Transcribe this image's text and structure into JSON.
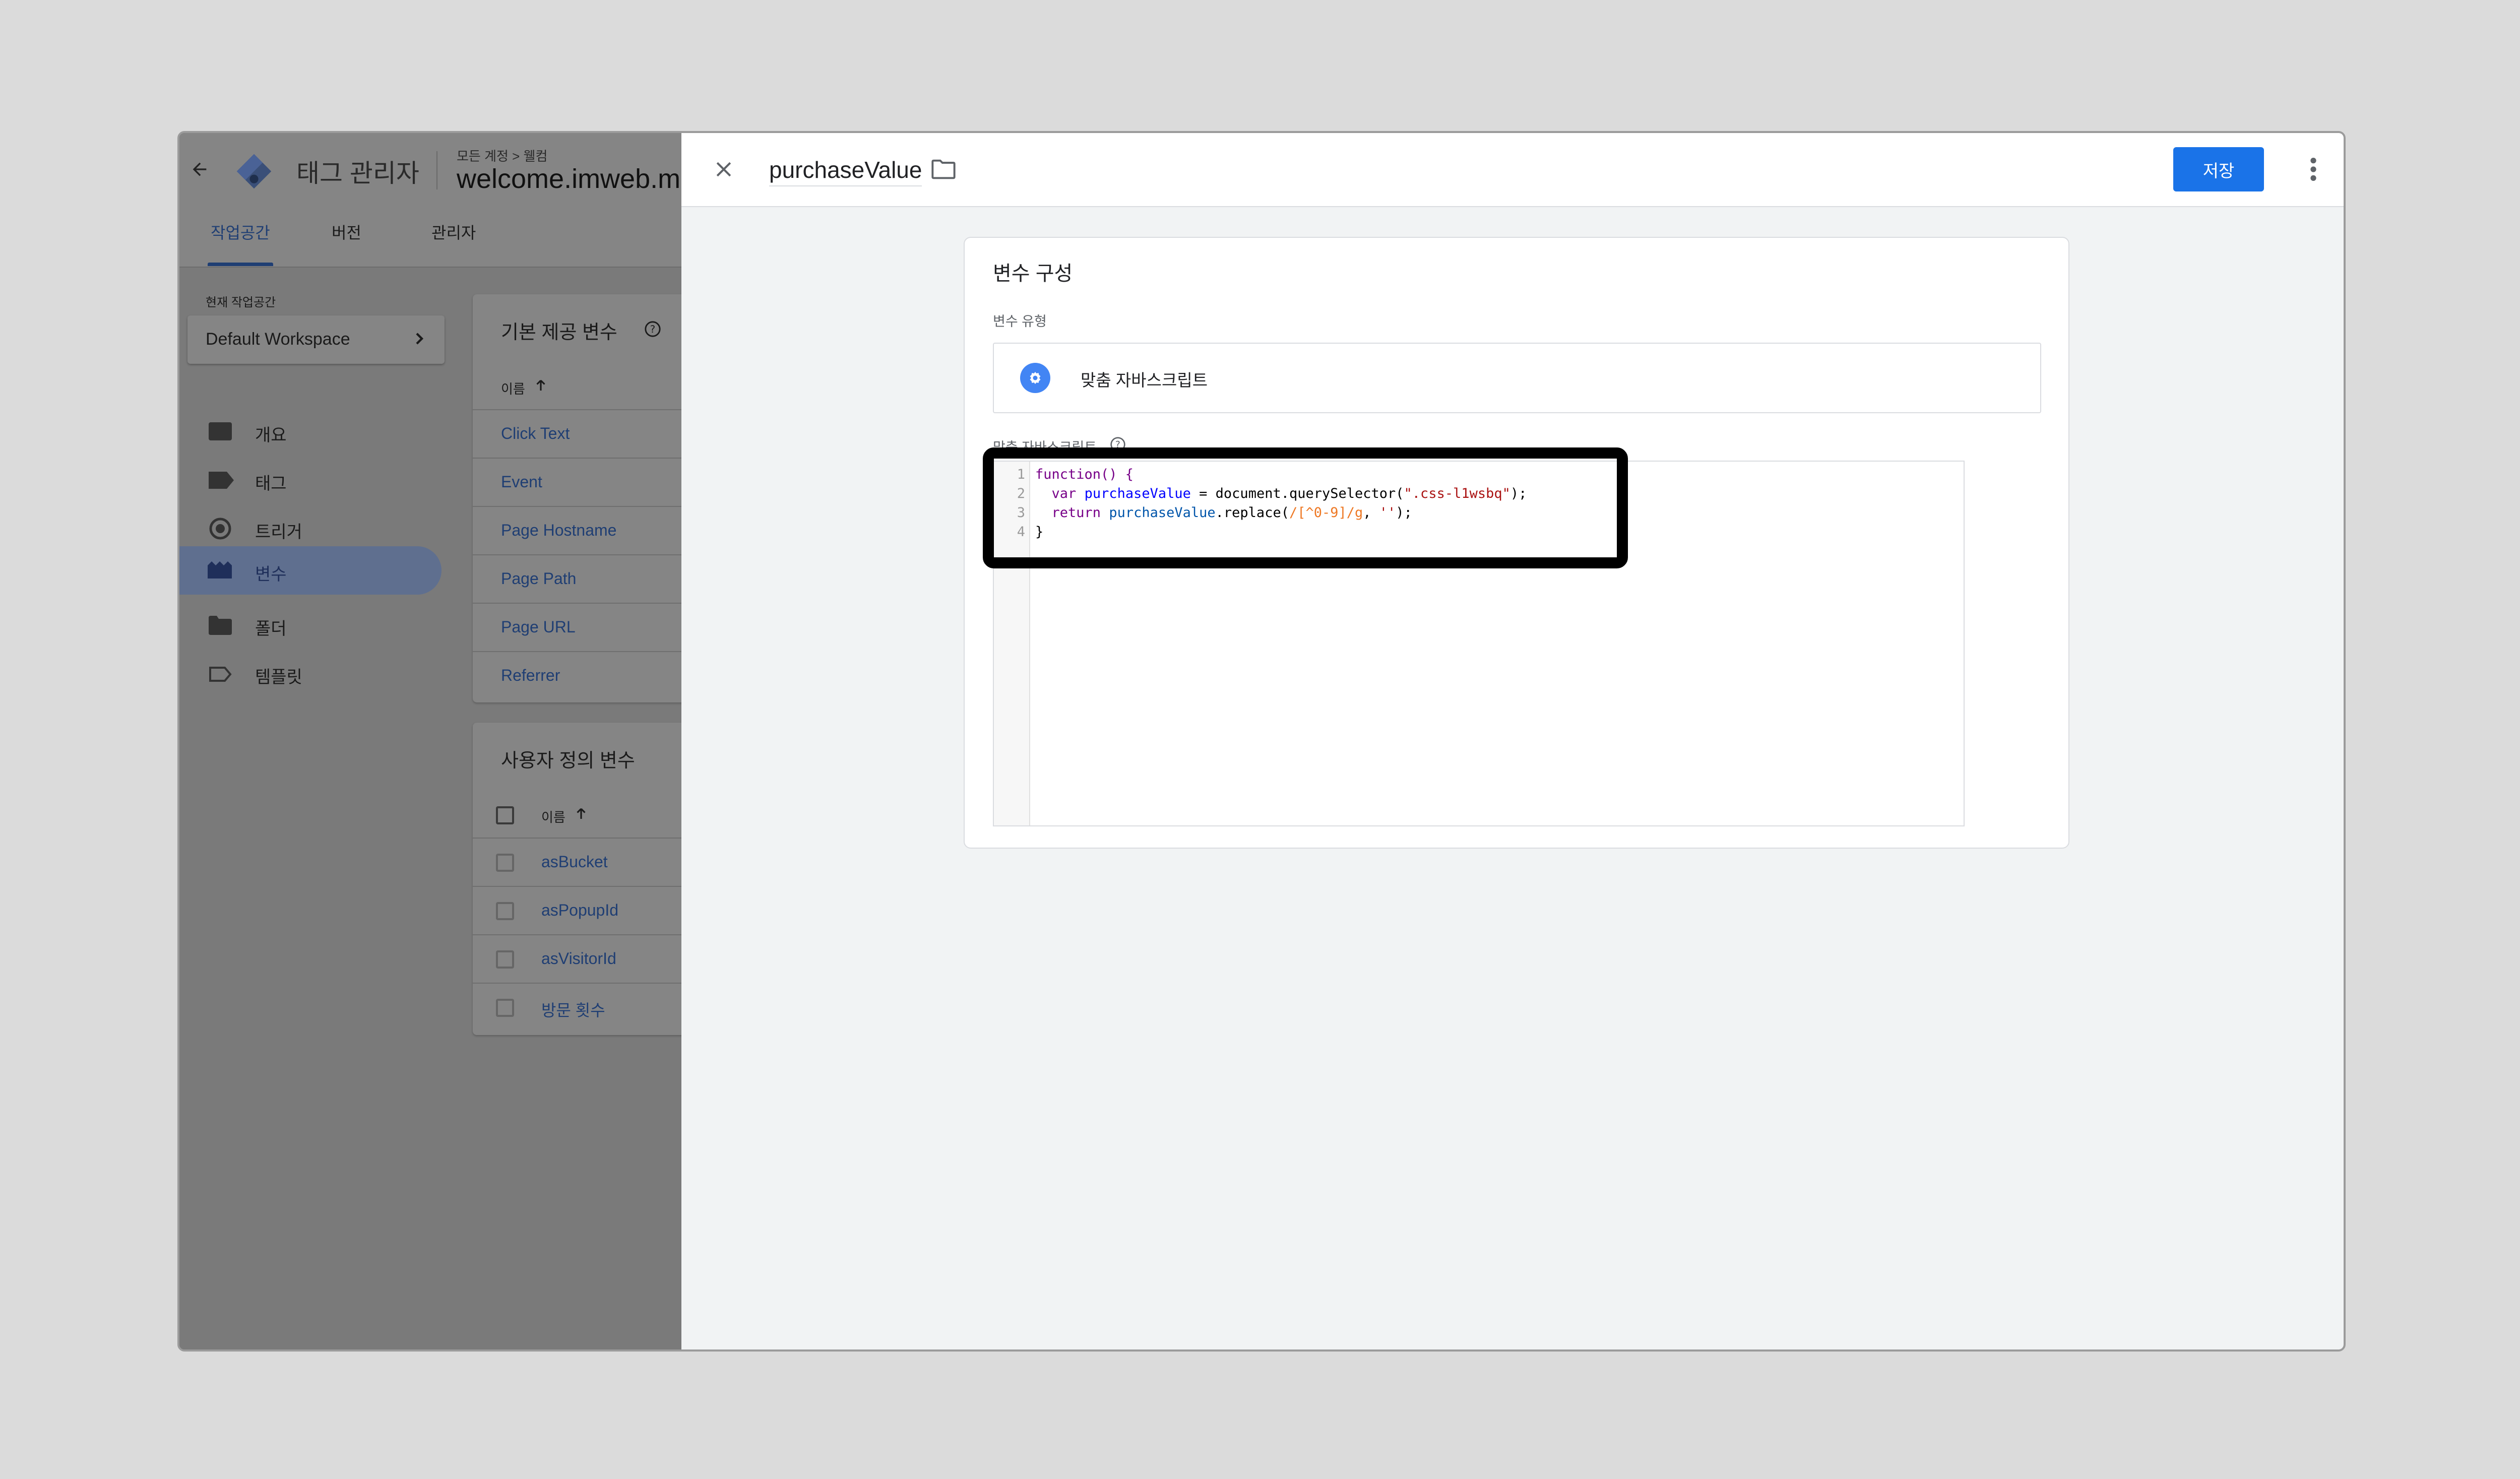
{
  "app": {
    "title": "태그 관리자",
    "breadcrumb": "모든 계정 > 웰컴",
    "container_name": "welcome.imweb.m",
    "tabs": [
      "작업공간",
      "버전",
      "관리자"
    ],
    "workspace_label": "현재 작업공간",
    "workspace_name": "Default Workspace",
    "nav": [
      "개요",
      "태그",
      "트리거",
      "변수",
      "폴더",
      "템플릿"
    ],
    "builtin": {
      "title": "기본 제공 변수",
      "col_name": "이름",
      "items": [
        "Click Text",
        "Event",
        "Page Hostname",
        "Page Path",
        "Page URL",
        "Referrer"
      ]
    },
    "user_defined": {
      "title": "사용자 정의 변수",
      "col_name": "이름",
      "items": [
        "asBucket",
        "asPopupId",
        "asVisitorId",
        "방문 횟수"
      ]
    }
  },
  "panel": {
    "variable_name": "purchaseValue",
    "save_label": "저장",
    "config_title": "변수 구성",
    "type_label": "변수 유형",
    "type_value": "맞춤 자바스크립트",
    "script_label": "맞춤 자바스크립트",
    "code": {
      "line1": "function() {",
      "line2_kw": "var",
      "line2_var": "purchaseValue",
      "line2_mid": "= document.querySelector(",
      "line2_str": "\".css-l1wsbq\"",
      "line2_end": ");",
      "line3_kw": "return",
      "line3_var": "purchaseValue",
      "line3_mid": ".replace(",
      "line3_re": "/[^0-9]/g",
      "line3_str": "''",
      "line3_end": ");",
      "line4": "}",
      "line_numbers": [
        "1",
        "2",
        "3",
        "4"
      ]
    }
  },
  "colors": {
    "accent": "#1a73e8",
    "selected_nav": "#5f6f8f"
  }
}
